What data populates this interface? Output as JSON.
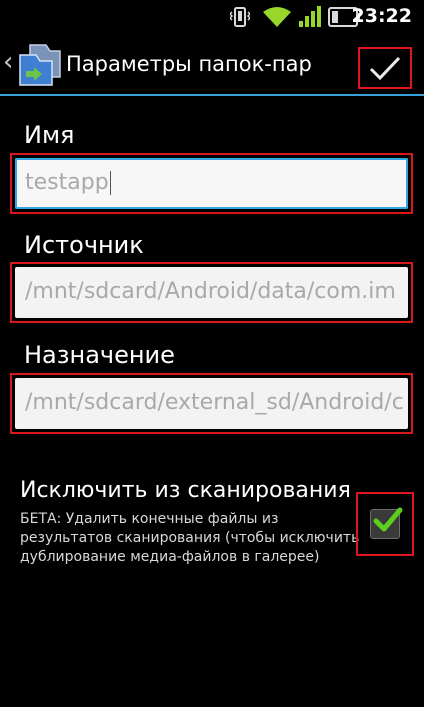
{
  "status_bar": {
    "time": "23:22",
    "icons": [
      "vibrate-icon",
      "wifi-icon",
      "signal-icon",
      "battery-icon"
    ]
  },
  "action_bar": {
    "title": "Параметры папок-пар",
    "confirm_icon": "checkmark-icon",
    "accent_color": "#3aa0d8"
  },
  "form": {
    "name": {
      "label": "Имя",
      "value": "testapp"
    },
    "source": {
      "label": "Источник",
      "value": "/mnt/sdcard/Android/data/com.im"
    },
    "destination": {
      "label": "Назначение",
      "value": "/mnt/sdcard/external_sd/Android/c"
    },
    "exclude": {
      "title": "Исключить из сканирования",
      "description": "БЕТА: Удалить конечные файлы из результатов сканирования (чтобы исключить дублирование медиа-файлов в галерее)",
      "checked": true
    }
  },
  "colors": {
    "highlight_red": "#e0161c",
    "check_green": "#5ccf1d"
  }
}
